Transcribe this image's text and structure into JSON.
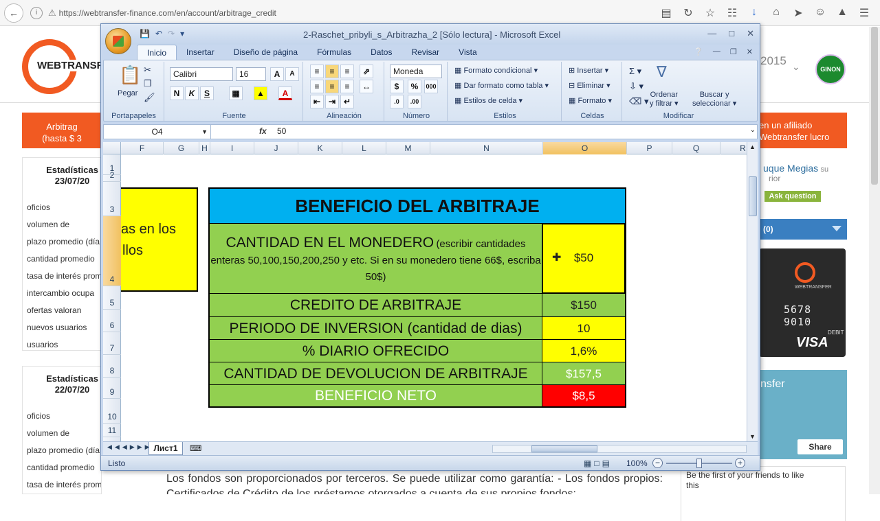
{
  "browser": {
    "url": "https://webtransfer-finance.com/en/account/arbitrage_credit"
  },
  "site": {
    "logo_text": "WEBTRANSF",
    "year": "2015",
    "ginon": "GINON",
    "orange_left": "Arbitra (hasta $ 3",
    "orange_left_l1": "Arbitrag",
    "orange_left_l2": "(hasta $ 3",
    "orange_right_l1": "en un afiliado",
    "orange_right_l2": "Webtransfer lucro",
    "stats1_title": "Estadísticas",
    "stats1_date": "23/07/20",
    "stats2_title": "Estadísticas",
    "stats2_date": "22/07/20",
    "stats_items": [
      "oficios",
      "volumen de",
      "plazo promedio (día",
      "cantidad promedio",
      "tasa de interés prom",
      "intercambio ocupa",
      "ofertas valoran",
      "nuevos usuarios",
      "usuarios"
    ],
    "stats2_items": [
      "oficios",
      "volumen de",
      "plazo promedio (día",
      "cantidad promedio",
      "tasa de interés promedio"
    ],
    "profile_name": "uque Megias",
    "profile_su": "su",
    "profile_sub": "rior",
    "ask": "Ask question",
    "blue_bar": "(0)",
    "card_name": "WEBTRANSFER",
    "card_number": "5678 9010",
    "card_debit": "DEBIT",
    "card_visa": "VISA",
    "social_name": "nsfer",
    "share": "Share",
    "fb_text": "Be the first of your friends to like this",
    "bottom_text": "Los fondos son proporcionados por terceros. Se puede utilizar como garantía: - Los fondos propios: Certificados de Crédito de los préstamos otorgados a cuenta de sus propios fondos;"
  },
  "excel": {
    "caption": "2-Raschet_pribyli_s_Arbitrazha_2  [Sólo lectura]  -  Microsoft Excel",
    "tabs": [
      "Inicio",
      "Insertar",
      "Diseño de página",
      "Fórmulas",
      "Datos",
      "Revisar",
      "Vista"
    ],
    "ribbon": {
      "pegar": "Pegar",
      "portapapeles": "Portapapeles",
      "font_name": "Calibri",
      "font_size": "16",
      "fuente": "Fuente",
      "alineacion": "Alineación",
      "number_format": "Moneda",
      "numero": "Número",
      "formato_condicional": "Formato condicional",
      "dar_formato": "Dar formato como tabla",
      "estilos_celda": "Estilos de celda",
      "estilos": "Estilos",
      "insertar": "Insertar",
      "eliminar": "Eliminar",
      "formato": "Formato",
      "celdas": "Celdas",
      "ordenar": "Ordenar",
      "y_filtrar": "y filtrar",
      "buscar": "Buscar y",
      "seleccionar": "seleccionar",
      "modificar": "Modificar"
    },
    "name_box": "O4",
    "fx": "fx",
    "formula_value": "50",
    "columns": [
      {
        "label": "F",
        "w": 62
      },
      {
        "label": "G",
        "w": 52
      },
      {
        "label": "H",
        "w": 16
      },
      {
        "label": "I",
        "w": 64
      },
      {
        "label": "J",
        "w": 64
      },
      {
        "label": "K",
        "w": 64
      },
      {
        "label": "L",
        "w": 64
      },
      {
        "label": "M",
        "w": 64
      },
      {
        "label": "N",
        "w": 164
      },
      {
        "label": "O",
        "w": 122
      },
      {
        "label": "P",
        "w": 66
      },
      {
        "label": "Q",
        "w": 70
      },
      {
        "label": "R",
        "w": 66
      }
    ],
    "rows": [
      "1",
      "2",
      "3",
      "4",
      "5",
      "6",
      "7",
      "8",
      "9",
      "10",
      "11"
    ],
    "partial_text_l1": "as en los",
    "partial_text_l2": "llos",
    "table": {
      "title": "BENEFICIO DEL ARBITRAJE",
      "monedero_label": "CANTIDAD EN EL MONEDERO",
      "monedero_note": "(escribir cantidades enteras 50,100,150,200,250 y etc. Si en su monedero tiene 66$, escriba 50$)",
      "monedero_value": "$50",
      "credito_label": "CREDITO DE ARBITRAJE",
      "credito_value": "$150",
      "periodo_label": "PERIODO DE INVERSION (cantidad de dias)",
      "periodo_value": "10",
      "diario_label": "% DIARIO OFRECIDO",
      "diario_value": "1,6%",
      "devolucion_label": "CANTIDAD DE DEVOLUCION DE ARBITRAJE",
      "devolucion_value": "$157,5",
      "neto_label": "BENEFICIO NETO",
      "neto_value": "$8,5"
    },
    "sheet_tab": "Лист1",
    "status": "Listo",
    "zoom": "100%",
    "colors": {
      "title": "#00b0f0",
      "label": "#92d050",
      "input": "#ffff00",
      "result": "#92d050",
      "neto": "#ff0000"
    }
  }
}
